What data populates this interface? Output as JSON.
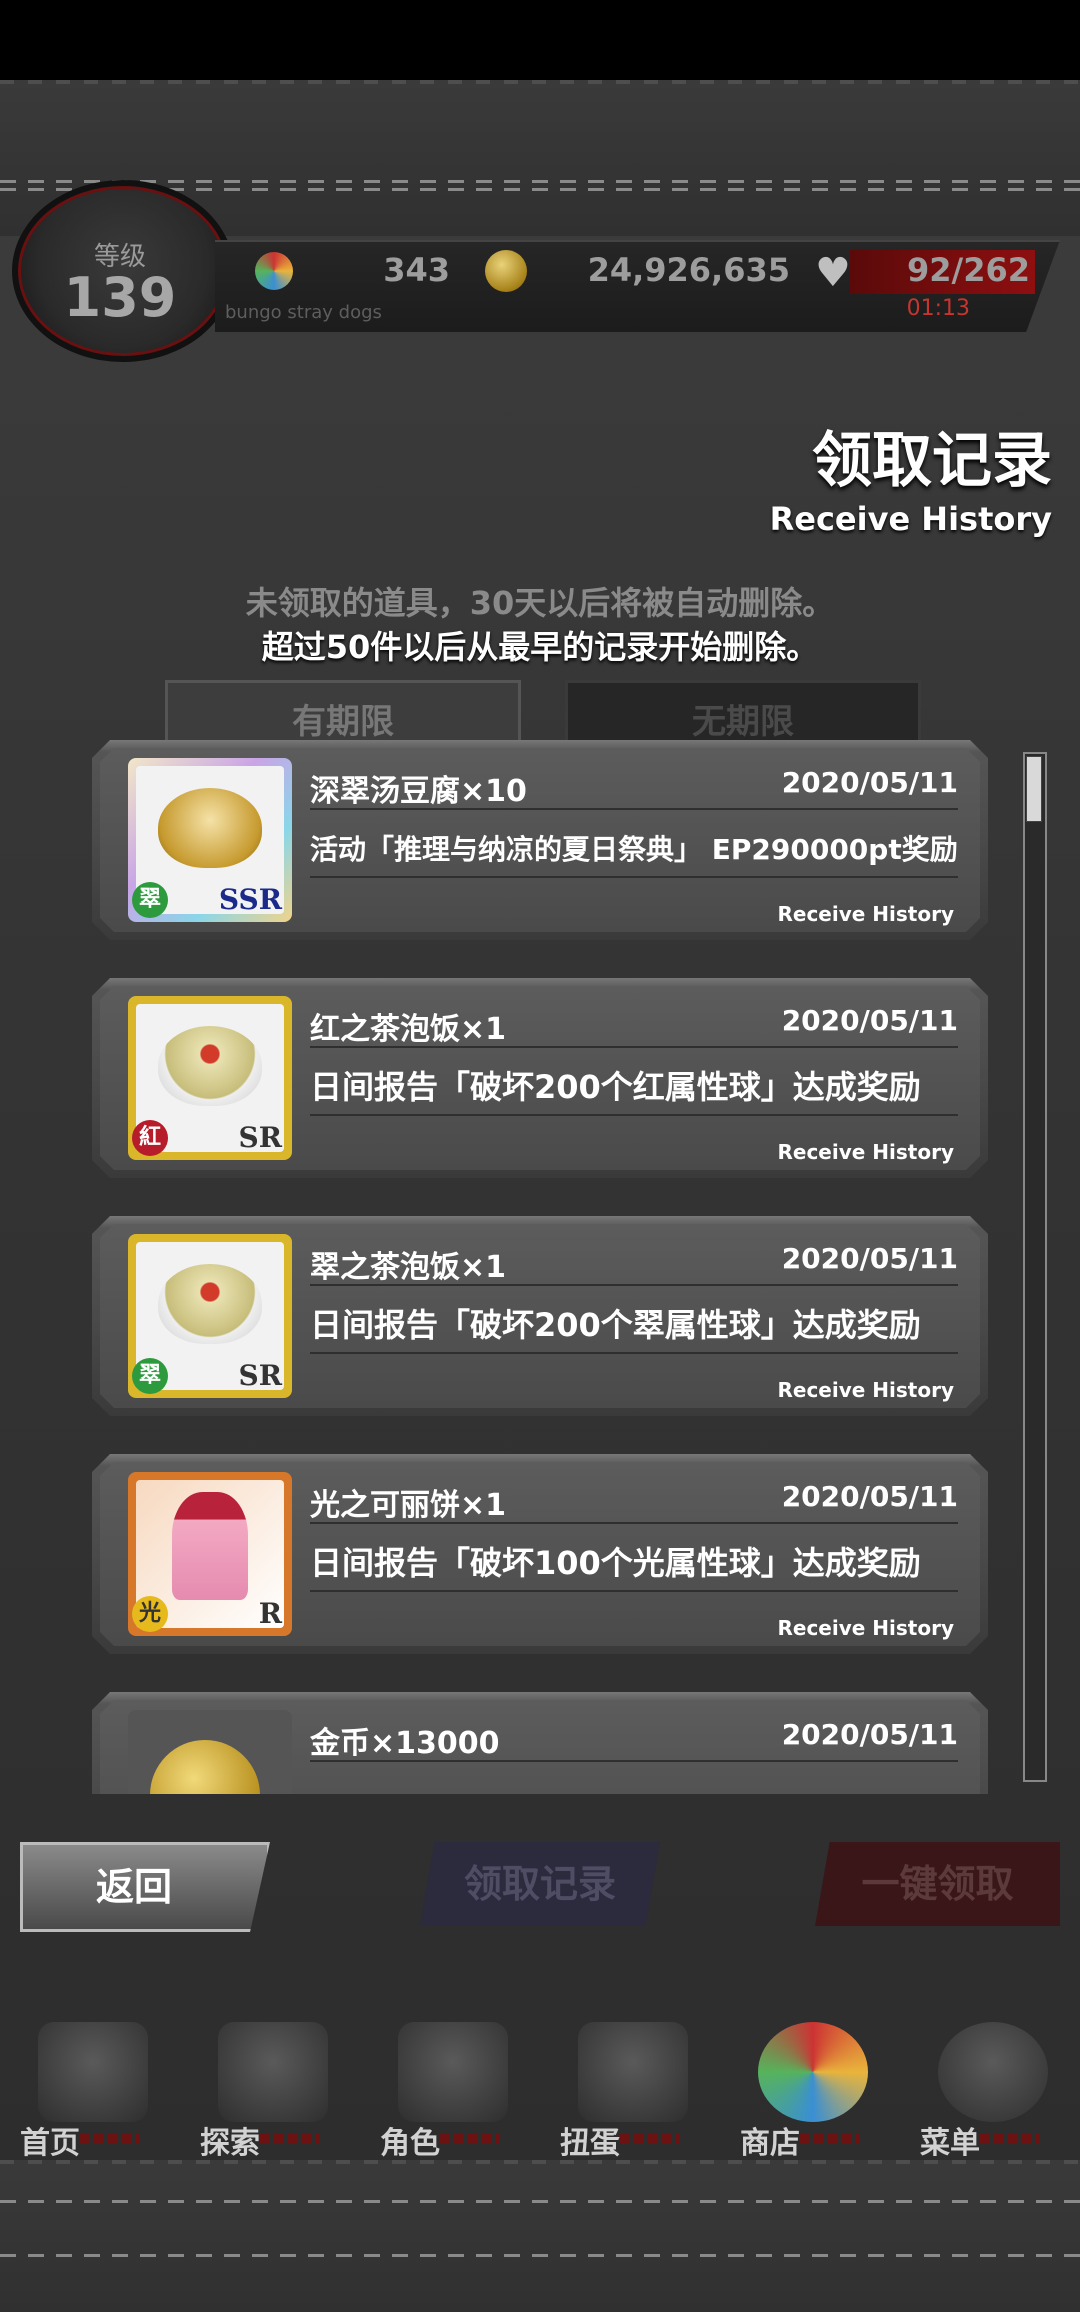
{
  "status": {
    "level_label": "等级",
    "level_value": "139",
    "gems": "343",
    "coins": "24,926,635",
    "stamina": "92/262",
    "stamina_timer": "01:13",
    "game_title": "bungo stray dogs"
  },
  "header": {
    "title": "领取记录",
    "subtitle": "Receive History",
    "notice_line1": "未领取的道具，30天以后将被自动删除。",
    "notice_line2": "超过50件以后从最早的记录开始删除。"
  },
  "tabs": {
    "limited": "有期限",
    "unlimited": "无期限"
  },
  "items": [
    {
      "name": "深翠汤豆腐×10",
      "date": "2020/05/11",
      "desc": "活动「推理与纳凉的夏日祭典」 EP290000pt奖励",
      "tag": "Receive History",
      "attr": "翠",
      "rarity": "SSR"
    },
    {
      "name": "红之茶泡饭×1",
      "date": "2020/05/11",
      "desc": "日间报告「破坏200个红属性球」达成奖励",
      "tag": "Receive History",
      "attr": "紅",
      "rarity": "SR"
    },
    {
      "name": "翠之茶泡饭×1",
      "date": "2020/05/11",
      "desc": "日间报告「破坏200个翠属性球」达成奖励",
      "tag": "Receive History",
      "attr": "翠",
      "rarity": "SR"
    },
    {
      "name": "光之可丽饼×1",
      "date": "2020/05/11",
      "desc": "日间报告「破坏100个光属性球」达成奖励",
      "tag": "Receive History",
      "attr": "光",
      "rarity": "R"
    },
    {
      "name": "金币×13000",
      "date": "2020/05/11"
    }
  ],
  "buttons": {
    "back": "返回",
    "history": "领取记录",
    "claim_all": "一键领取"
  },
  "nav": [
    {
      "label": "首页",
      "icon": "home-icon"
    },
    {
      "label": "探索",
      "icon": "explore-icon"
    },
    {
      "label": "角色",
      "icon": "characters-icon"
    },
    {
      "label": "扭蛋",
      "icon": "gacha-icon"
    },
    {
      "label": "商店",
      "icon": "shop-icon"
    },
    {
      "label": "菜单",
      "icon": "menu-gear-icon"
    }
  ],
  "colors": {
    "accent_red": "#8e0f10",
    "card_bg": "#4a4a4a"
  }
}
